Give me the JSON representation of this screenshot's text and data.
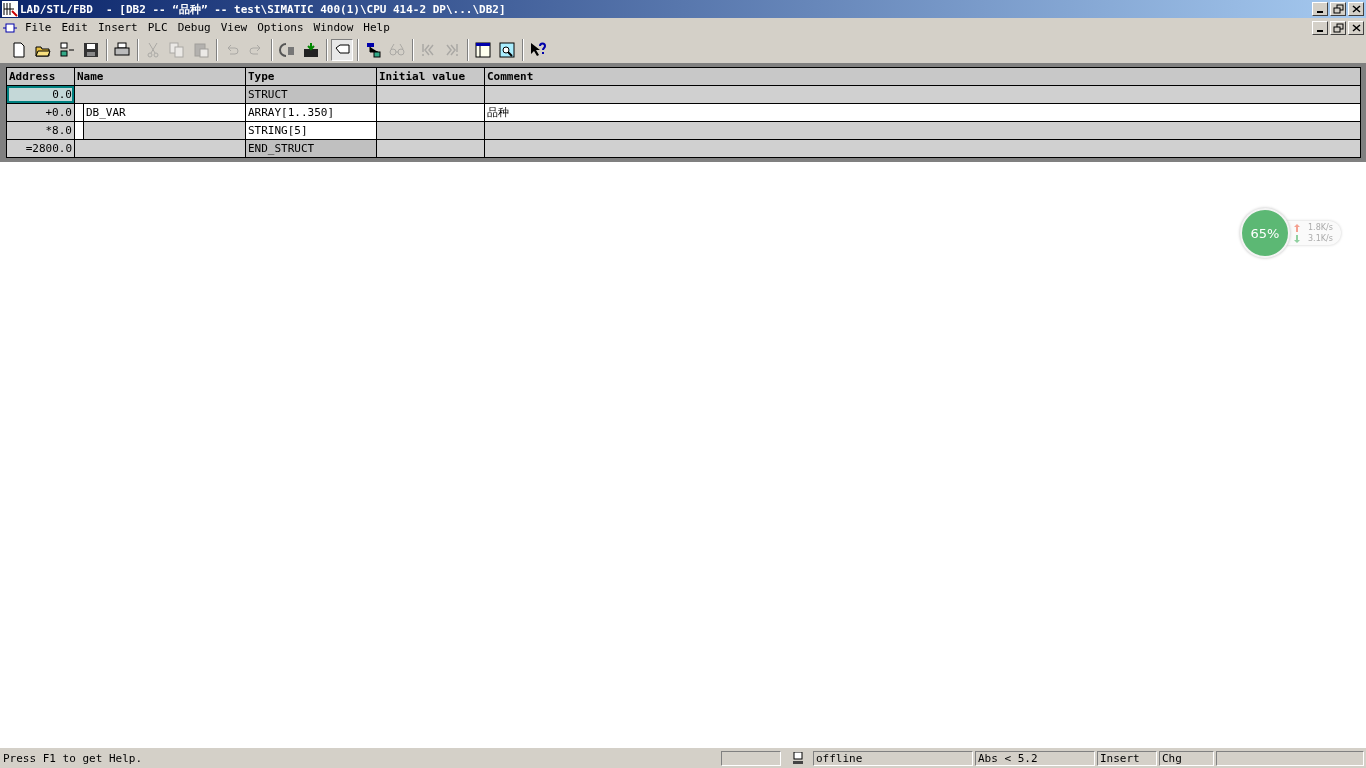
{
  "window": {
    "title": "LAD/STL/FBD  - [DB2 -- “品种” -- test\\SIMATIC 400(1)\\CPU 414-2 DP\\...\\DB2]"
  },
  "menu": [
    "File",
    "Edit",
    "Insert",
    "PLC",
    "Debug",
    "View",
    "Options",
    "Window",
    "Help"
  ],
  "toolbar": [
    [
      {
        "disabled": false,
        "on": false
      },
      {
        "disabled": false,
        "on": false
      },
      {
        "disabled": false,
        "on": false
      },
      {
        "disabled": false,
        "on": false
      }
    ],
    [
      {
        "disabled": false,
        "on": false
      }
    ],
    [
      {
        "disabled": true,
        "on": false
      },
      {
        "disabled": true,
        "on": false
      },
      {
        "disabled": true,
        "on": false
      }
    ],
    [
      {
        "disabled": true,
        "on": false
      },
      {
        "disabled": true,
        "on": false
      }
    ],
    [
      {
        "disabled": false,
        "on": false
      },
      {
        "disabled": false,
        "on": false
      }
    ],
    [
      {
        "disabled": false,
        "on": true
      }
    ],
    [
      {
        "disabled": false,
        "on": false
      },
      {
        "disabled": true,
        "on": false
      }
    ],
    [
      {
        "disabled": true,
        "on": false
      },
      {
        "disabled": true,
        "on": false
      }
    ],
    [
      {
        "disabled": false,
        "on": false
      },
      {
        "disabled": false,
        "on": false
      }
    ],
    [
      {
        "disabled": false,
        "on": false
      }
    ]
  ],
  "table": {
    "columns": [
      "Address",
      "Name",
      "Type",
      "Initial value",
      "Comment"
    ],
    "rows": [
      {
        "selected": true,
        "nested": false,
        "cells": [
          {
            "text": "0.0",
            "editable": false
          },
          {
            "editable": false
          },
          {
            "text": "STRUCT",
            "editable": false
          },
          {
            "editable": false
          },
          {
            "editable": false
          }
        ]
      },
      {
        "selected": false,
        "nested": true,
        "cells": [
          {
            "text": "+0.0",
            "editable": false
          },
          {
            "text": "DB_VAR",
            "editable": true
          },
          {
            "text": "ARRAY[1..350]",
            "editable": true
          },
          {
            "editable": true
          },
          {
            "text": "品种",
            "editable": true
          }
        ]
      },
      {
        "selected": false,
        "nested": true,
        "cells": [
          {
            "text": "*8.0",
            "editable": false
          },
          {
            "editable": false
          },
          {
            "text": "STRING[5]",
            "editable": true
          },
          {
            "editable": false
          },
          {
            "editable": false
          }
        ]
      },
      {
        "selected": false,
        "nested": false,
        "cells": [
          {
            "text": "=2800.0",
            "editable": false
          },
          {
            "editable": false
          },
          {
            "text": "END_STRUCT",
            "editable": false
          },
          {
            "editable": false
          },
          {
            "editable": false
          }
        ]
      }
    ]
  },
  "net_monitor": {
    "usage": "65%",
    "upload": "1.8K/s",
    "download": "3.1K/s"
  },
  "status_bar": {
    "help": "Press F1 to get Help.",
    "connection": "offline",
    "position": "Abs < 5.2",
    "mode": "Insert",
    "change": "Chg"
  }
}
